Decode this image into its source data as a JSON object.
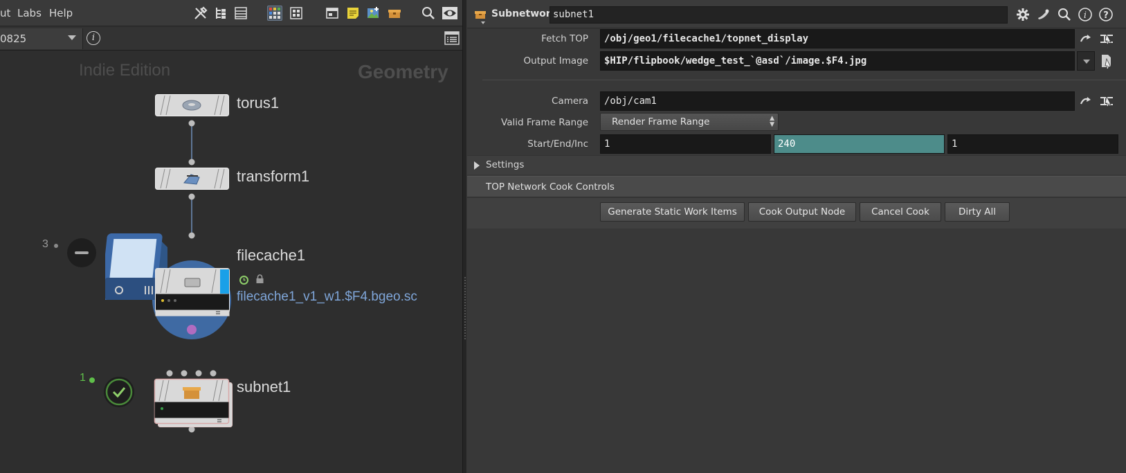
{
  "menubar": {
    "items": [
      "ut",
      "Labs",
      "Help"
    ]
  },
  "pathbar": {
    "path_value": "0825"
  },
  "network": {
    "watermark_edition": "Indie Edition",
    "watermark_context": "Geometry",
    "nodes": [
      {
        "name": "torus1"
      },
      {
        "name": "transform1"
      },
      {
        "name": "filecache1",
        "file": "filecache1_v1_w1.$F4.bgeo.sc",
        "badge": "3"
      },
      {
        "name": "subnet1",
        "badge": "1"
      }
    ]
  },
  "params": {
    "node_type": "Subnetwork",
    "node_name": "subnet1",
    "fetch_top_label": "Fetch TOP",
    "fetch_top_value": "/obj/geo1/filecache1/topnet_display",
    "output_image_label": "Output Image",
    "output_image_value": "$HIP/flipbook/wedge_test_`@asd`/image.$F4.jpg",
    "camera_label": "Camera",
    "camera_value": "/obj/cam1",
    "valid_frame_range_label": "Valid Frame Range",
    "valid_frame_range_value": "Render Frame Range",
    "start_end_inc_label": "Start/End/Inc",
    "start_value": "1",
    "end_value": "240",
    "inc_value": "1",
    "settings_label": "Settings",
    "cook_controls_label": "TOP Network Cook Controls",
    "buttons": {
      "generate": "Generate Static Work Items",
      "cook_output": "Cook Output Node",
      "cancel": "Cancel Cook",
      "dirty": "Dirty All"
    }
  },
  "colors": {
    "accent_highlight": "#4d8c8a",
    "file_link": "#7fa6d9",
    "badge_green": "#5fbf4a"
  }
}
